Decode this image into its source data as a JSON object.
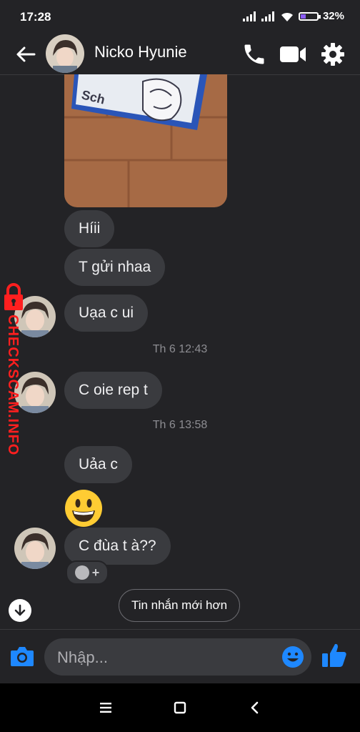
{
  "status_bar": {
    "time": "17:28",
    "battery_text": "32%",
    "battery_level": 0.32
  },
  "header": {
    "contact_name": "Nicko Hyunie"
  },
  "messages": [
    {
      "text": "Híii"
    },
    {
      "text": "T gửi nhaa"
    },
    {
      "text": "Uạa c ui"
    },
    {
      "text": "C oie rep t"
    },
    {
      "text": "Uảa c"
    },
    {
      "text": "C đùa t à??"
    }
  ],
  "timestamps": [
    "Th 6 12:43",
    "Th 6 13:58"
  ],
  "photo_text": "Sch",
  "newer_messages_label": "Tin nhắn mới hơn",
  "composer": {
    "placeholder": "Nhập..."
  },
  "watermark": {
    "text": "CHECKSCAM.INFO"
  },
  "colors": {
    "background": "#232326",
    "bubble": "#3a3b3f",
    "accent": "#1e88ff",
    "watermark": "#ff1f1f",
    "battery_fill": "#8b5cf6"
  }
}
